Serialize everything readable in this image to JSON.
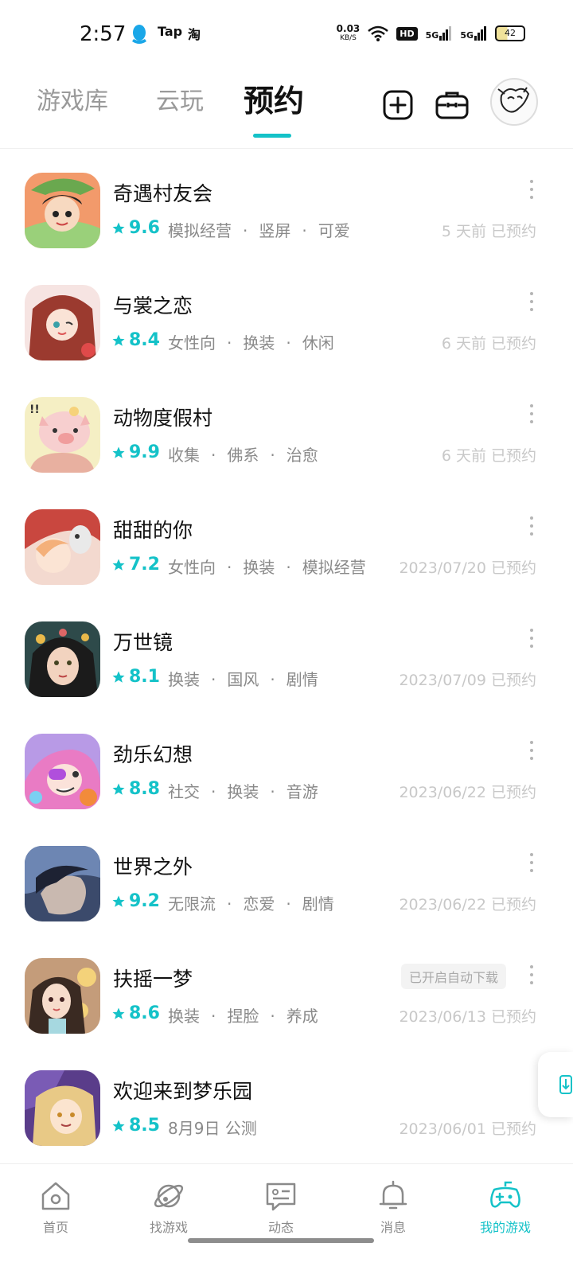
{
  "status_bar": {
    "time": "2:57",
    "apps": [
      "Tap",
      "淘"
    ],
    "net_speed": "0.03",
    "net_unit": "KB/S",
    "hd": "HD",
    "signal_1": "5G",
    "signal_2": "5G",
    "battery": "42"
  },
  "tabs": {
    "library": "游戏库",
    "cloud": "云玩",
    "reserve": "预约"
  },
  "accent_color": "#14c2c8",
  "games": [
    {
      "title": "奇遇村友会",
      "rating": "9.6",
      "tags": [
        "模拟经营",
        "竖屏",
        "可爱"
      ],
      "reserved": "5 天前 已预约"
    },
    {
      "title": "与裳之恋",
      "rating": "8.4",
      "tags": [
        "女性向",
        "换装",
        "休闲"
      ],
      "reserved": "6 天前 已预约"
    },
    {
      "title": "动物度假村",
      "rating": "9.9",
      "tags": [
        "收集",
        "佛系",
        "治愈"
      ],
      "reserved": "6 天前 已预约"
    },
    {
      "title": "甜甜的你",
      "rating": "7.2",
      "tags": [
        "女性向",
        "换装",
        "模拟经营"
      ],
      "reserved": "2023/07/20 已预约"
    },
    {
      "title": "万世镜",
      "rating": "8.1",
      "tags": [
        "换装",
        "国风",
        "剧情"
      ],
      "reserved": "2023/07/09 已预约"
    },
    {
      "title": "劲乐幻想",
      "rating": "8.8",
      "tags": [
        "社交",
        "换装",
        "音游"
      ],
      "reserved": "2023/06/22 已预约"
    },
    {
      "title": "世界之外",
      "rating": "9.2",
      "tags": [
        "无限流",
        "恋爱",
        "剧情"
      ],
      "reserved": "2023/06/22 已预约"
    },
    {
      "title": "扶摇一梦",
      "rating": "8.6",
      "tags": [
        "换装",
        "捏脸",
        "养成"
      ],
      "reserved": "2023/06/13 已预约",
      "badge": "已开启自动下载"
    },
    {
      "title": "欢迎来到梦乐园",
      "rating": "8.5",
      "tags": [
        "8月9日 公测"
      ],
      "reserved": "2023/06/01 已预约"
    }
  ],
  "nav": {
    "home": "首页",
    "find": "找游戏",
    "feed": "动态",
    "messages": "消息",
    "my_games": "我的游戏"
  }
}
